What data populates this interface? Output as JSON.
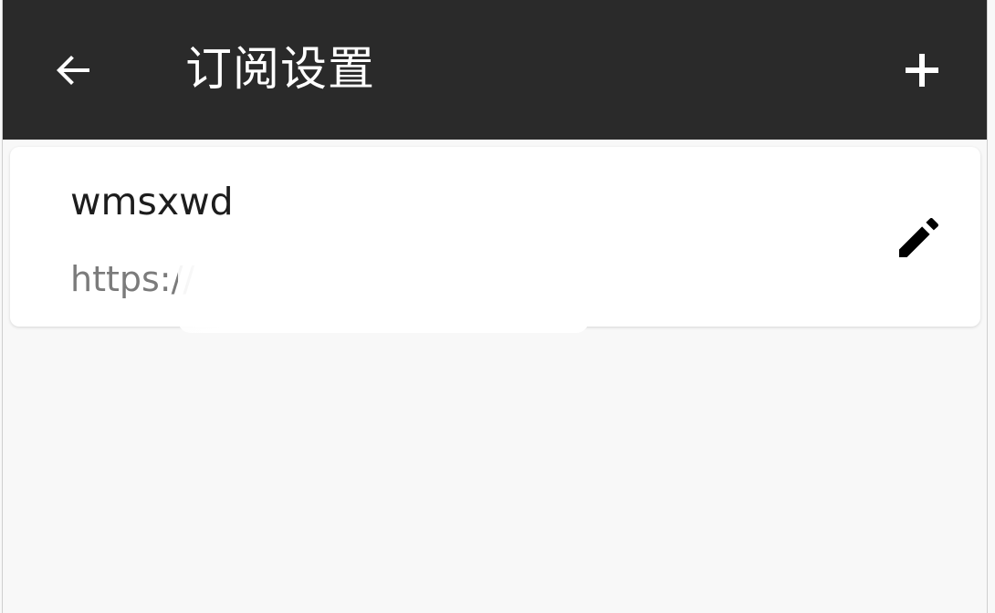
{
  "app_bar": {
    "title": "订阅设置",
    "back_icon": "arrow-back-icon",
    "add_icon": "plus-icon",
    "background": "#2a2a2a",
    "foreground": "#ffffff"
  },
  "subscriptions": [
    {
      "name": "wmsxwd",
      "url": "https://",
      "edit_icon": "pencil-icon"
    }
  ],
  "colors": {
    "page_background": "#f8f8f8",
    "card_background": "#ffffff",
    "primary_text": "#1d1d1d",
    "secondary_text": "#7b7b7b"
  }
}
